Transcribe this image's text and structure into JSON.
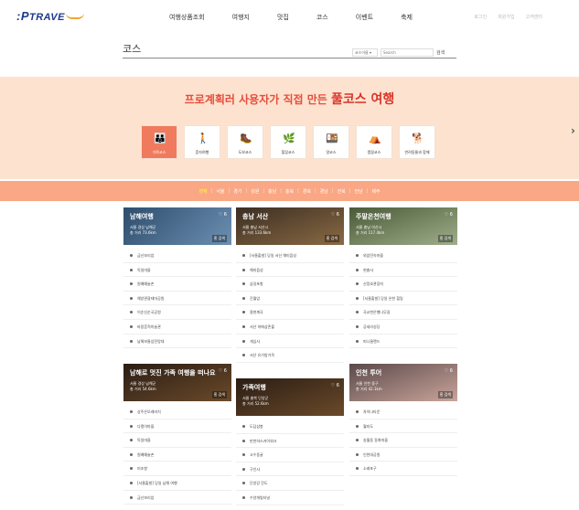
{
  "header": {
    "logo_p": ":P",
    "logo_text": "TRAVE",
    "nav": [
      "여행상품조회",
      "여행지",
      "맛집",
      "코스",
      "이벤트",
      "축제"
    ],
    "util": [
      "로그인",
      "회원가입",
      "고객센터"
    ]
  },
  "title_bar": {
    "title": "코스",
    "select_value": "코스이름 ▾",
    "search_placeholder": "Search",
    "search_button": "검색"
  },
  "hero": {
    "title_prefix": "프로계획러 사용자가 직접 만든",
    "title_highlight": "풀코스 여행",
    "categories": [
      {
        "label": "가족코스",
        "icon": "family-icon",
        "glyph": "👪",
        "active": true
      },
      {
        "label": "혼자여행",
        "icon": "solo-hiker-icon",
        "glyph": "🚶",
        "active": false
      },
      {
        "label": "도보코스",
        "icon": "walking-icon",
        "glyph": "🥾",
        "active": false
      },
      {
        "label": "힐링코스",
        "icon": "leaf-icon",
        "glyph": "🌿",
        "active": false
      },
      {
        "label": "맛코스",
        "icon": "food-icon",
        "glyph": "🍱",
        "active": false
      },
      {
        "label": "캠핑코스",
        "icon": "tent-icon",
        "glyph": "⛺",
        "active": false
      },
      {
        "label": "반려동물과 함께",
        "icon": "pet-icon",
        "glyph": "🐕",
        "active": false
      }
    ]
  },
  "regions": [
    "전체",
    "서울",
    "경기",
    "강원",
    "충남",
    "충북",
    "경북",
    "경남",
    "전북",
    "전남",
    "제주"
  ],
  "active_region": "전체",
  "cards": [
    {
      "name": "남해여행",
      "likes": "♡ 6",
      "sub1": "서울 경상 남해군",
      "sub2": "총 거리 73.6km",
      "tag": "홈 검색",
      "items": [
        "금산보리암",
        "독일마을",
        "원예예술촌",
        "해양관광테마공원",
        "이순신순국공원",
        "바람흔적미술관",
        "남해보물섬전망대"
      ]
    },
    {
      "name": "충남 서산",
      "likes": "♡ 6",
      "sub1": "서울 충남 서산시",
      "sub2": "총 거리 133.6km",
      "tag": "홈 검색",
      "items": [
        "[서울출발] 당일 서산 해미읍성",
        "해미읍성",
        "삼길포항",
        "간월암",
        "용현계곡",
        "서산 마애삼존불",
        "개심사",
        "서산 유기방가옥"
      ]
    },
    {
      "name": "주말온천여행",
      "likes": "♡ 6",
      "sub1": "서울 충남 아산시",
      "sub2": "총 거리 117.4km",
      "tag": "홈 검색",
      "items": [
        "외암민속마을",
        "현충사",
        "신정호관광지",
        "[서울출발] 당일 온천 힐링",
        "곡교천은행나무길",
        "공세리성당",
        "피나클랜드"
      ]
    },
    {
      "name": "남해로 멋진 가족 여행을 떠나요",
      "likes": "♡ 6",
      "sub1": "서울 경상 남해군",
      "sub2": "총 거리 54.6km",
      "tag": "홈 검색",
      "items": [
        "상주은모래비치",
        "다랭이마을",
        "독일마을",
        "원예예술촌",
        "미조항",
        "[서울출발] 당일 남해 여행",
        "금산보리암"
      ]
    },
    {
      "name": "가족여행",
      "likes": "♡ 6",
      "sub1": "서울 충북 단양군",
      "sub2": "총 거리 52.6km",
      "tag": "홈 검색",
      "items": [
        "도담삼봉",
        "만천하스카이워크",
        "고수동굴",
        "구인사",
        "단양강 잔도",
        "수양개빛터널"
      ]
    },
    {
      "name": "인천 투어",
      "likes": "♡ 6",
      "sub1": "서울 인천 중구",
      "sub2": "총 거리 42.1km",
      "tag": "홈 검색",
      "items": [
        "차이나타운",
        "월미도",
        "송월동 동화마을",
        "인천대공원",
        "소래포구"
      ]
    }
  ]
}
